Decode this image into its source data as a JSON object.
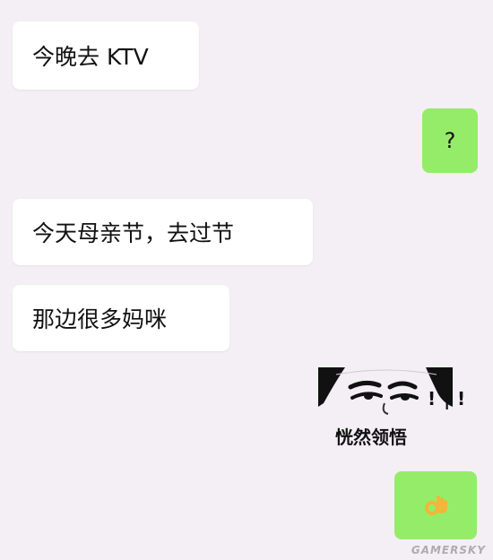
{
  "messages": [
    {
      "id": "m1",
      "side": "incoming",
      "text": "今晚去 KTV"
    },
    {
      "id": "m2",
      "side": "outgoing",
      "text": "?"
    },
    {
      "id": "m3",
      "side": "incoming",
      "text": "今天母亲节，去过节"
    },
    {
      "id": "m4",
      "side": "incoming",
      "text": "那边很多妈咪"
    },
    {
      "id": "m5",
      "side": "outgoing",
      "type": "sticker",
      "caption": "恍然领悟",
      "marks": "! | !"
    },
    {
      "id": "m6",
      "side": "outgoing",
      "type": "emoji",
      "emoji": "ok-hand-icon"
    }
  ],
  "colors": {
    "background": "#f4eff5",
    "incoming_bubble": "#ffffff",
    "outgoing_bubble": "#95ec69",
    "text": "#111111"
  },
  "watermark": "GAMERSKY"
}
